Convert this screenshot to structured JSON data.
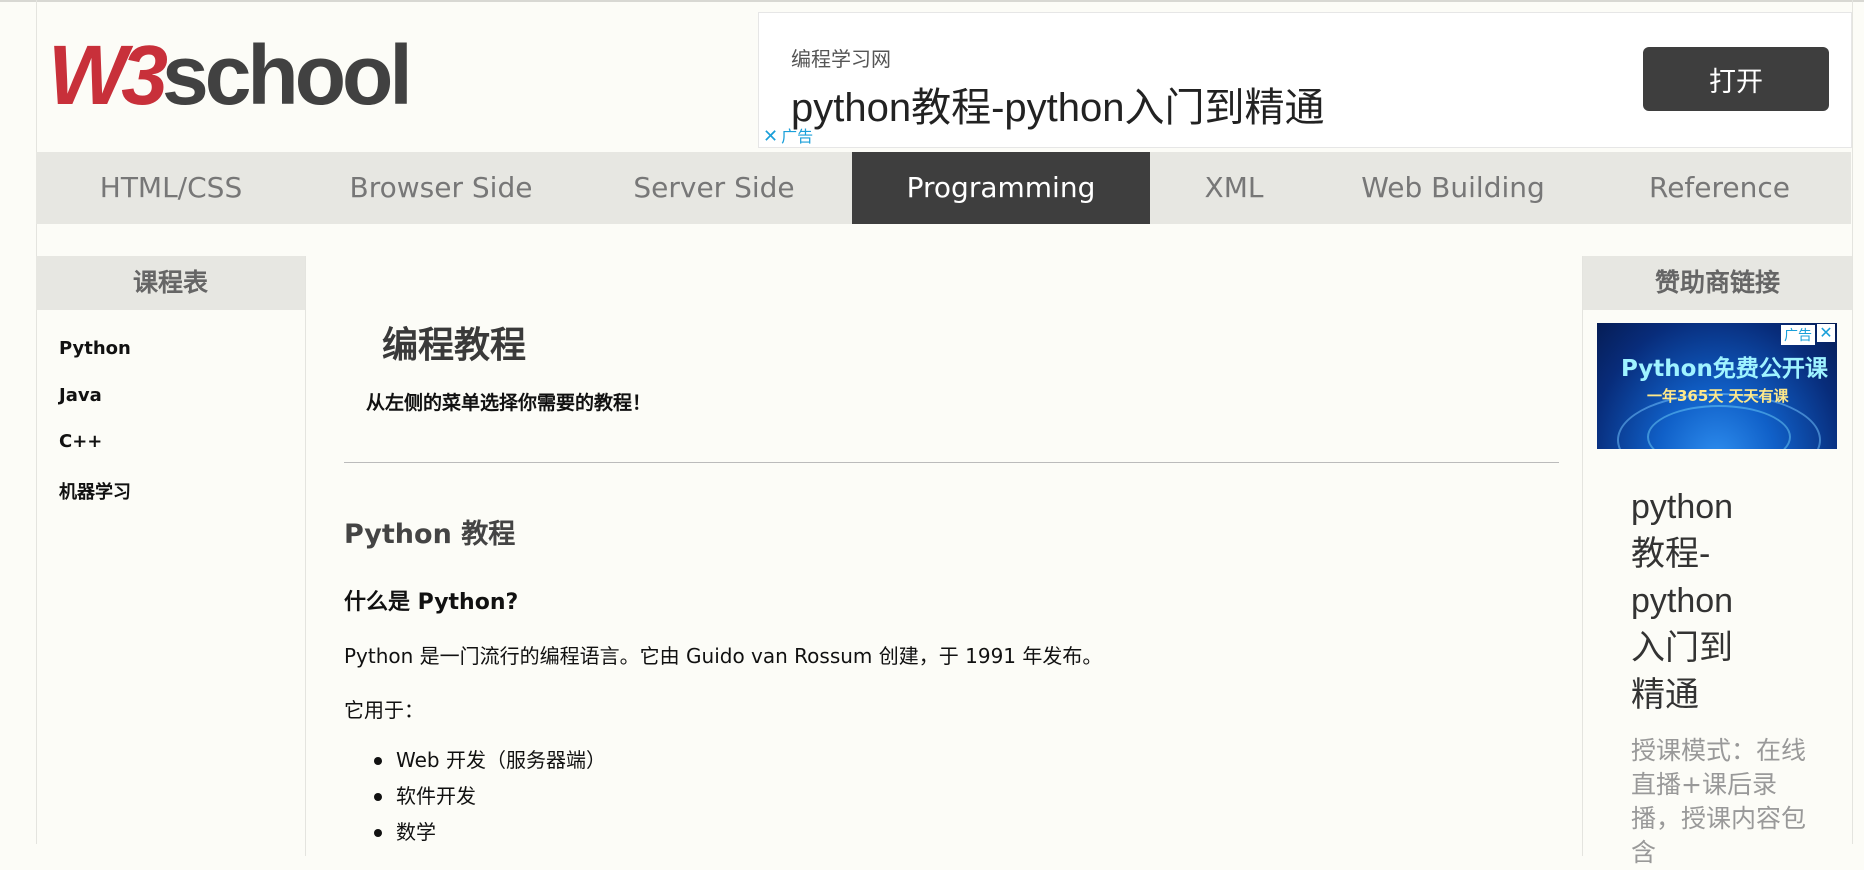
{
  "logo": {
    "part1": "W3",
    "part2": "school"
  },
  "top_ad": {
    "source": "编程学习网",
    "title": "python教程-python入门到精通",
    "button_label": "打开",
    "ad_label": "广告"
  },
  "nav": {
    "items": [
      {
        "label": "HTML/CSS"
      },
      {
        "label": "Browser Side"
      },
      {
        "label": "Server Side"
      },
      {
        "label": "Programming",
        "active": true
      },
      {
        "label": "XML"
      },
      {
        "label": "Web Building"
      },
      {
        "label": "Reference"
      }
    ]
  },
  "left_sidebar": {
    "title": "课程表",
    "links": [
      "Python",
      "Java",
      "C++",
      "机器学习"
    ]
  },
  "main": {
    "title": "编程教程",
    "subtitle": "从左侧的菜单选择你需要的教程！",
    "section_title": "Python 教程",
    "question": "什么是 Python?",
    "intro": "Python 是一门流行的编程语言。它由 Guido van Rossum 创建，于 1991 年发布。",
    "uses_label": "它用于：",
    "uses": [
      "Web 开发（服务器端）",
      "软件开发",
      "数学"
    ]
  },
  "right_sidebar": {
    "title": "赞助商链接",
    "banner": {
      "tag": "广告",
      "headline": "Python免费公开课",
      "tagline": "一年365天 天天有课"
    },
    "ad_title": "python教程-python入门到精通",
    "ad_desc": "授课模式：在线直播+课后录播，授课内容包含"
  },
  "colors": {
    "brand_red": "#c8303a",
    "nav_active": "#3e3e3e",
    "nav_bg": "#e7e7e2",
    "ad_link": "#1a9fd9"
  }
}
